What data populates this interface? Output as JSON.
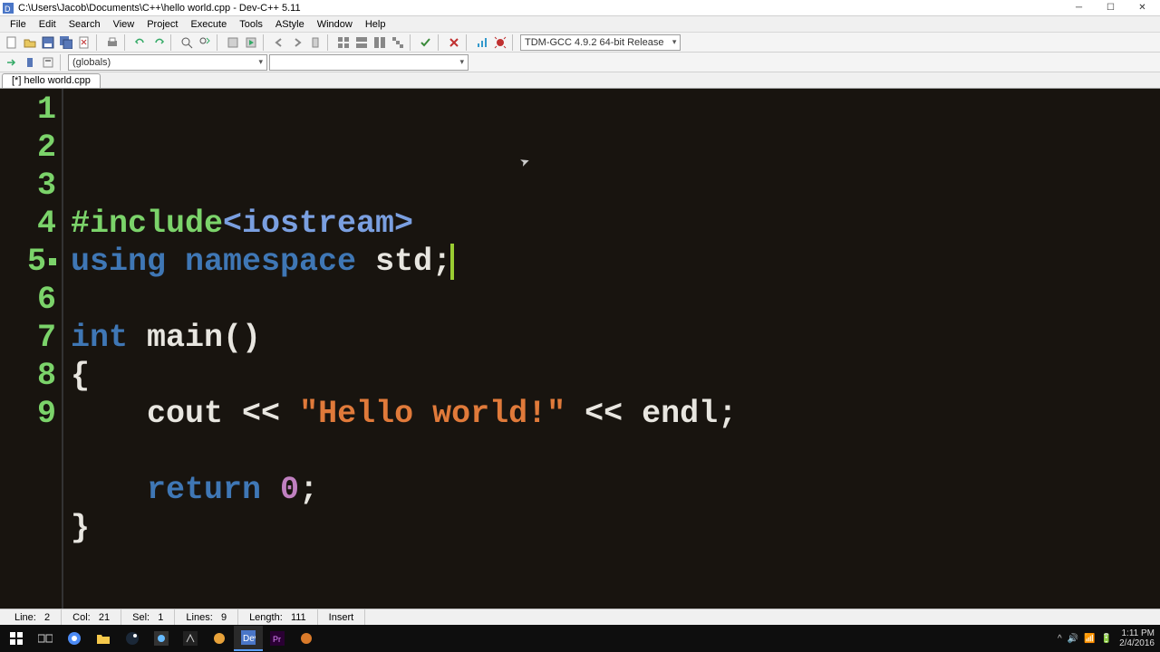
{
  "window": {
    "title": "C:\\Users\\Jacob\\Documents\\C++\\hello world.cpp - Dev-C++ 5.11"
  },
  "menu": {
    "items": [
      "File",
      "Edit",
      "Search",
      "View",
      "Project",
      "Execute",
      "Tools",
      "AStyle",
      "Window",
      "Help"
    ]
  },
  "toolbar": {
    "compiler_select": "TDM-GCC 4.9.2 64-bit Release"
  },
  "toolbar2": {
    "scope_select": "(globals)",
    "member_select": ""
  },
  "tab": {
    "label": "[*] hello world.cpp"
  },
  "code": {
    "lines": [
      {
        "n": "1",
        "tokens": [
          {
            "t": "#include",
            "c": "tok-pre"
          },
          {
            "t": "<iostream>",
            "c": "tok-inc"
          }
        ]
      },
      {
        "n": "2",
        "hl": true,
        "caret": true,
        "tokens": [
          {
            "t": "using namespace ",
            "c": "tok-kw"
          },
          {
            "t": "std",
            "c": "tok-id"
          },
          {
            "t": ";",
            "c": "tok-id"
          }
        ]
      },
      {
        "n": "3",
        "tokens": []
      },
      {
        "n": "4",
        "tokens": [
          {
            "t": "int ",
            "c": "tok-kw"
          },
          {
            "t": "main",
            "c": "tok-id"
          },
          {
            "t": "()",
            "c": "tok-id"
          }
        ]
      },
      {
        "n": "5",
        "fold": true,
        "tokens": [
          {
            "t": "{",
            "c": "tok-id"
          }
        ]
      },
      {
        "n": "6",
        "tokens": [
          {
            "t": "    cout ",
            "c": "tok-id"
          },
          {
            "t": "<<",
            "c": "tok-id"
          },
          {
            "t": " ",
            "c": "tok-id"
          },
          {
            "t": "\"Hello world!\"",
            "c": "tok-str"
          },
          {
            "t": " ",
            "c": "tok-id"
          },
          {
            "t": "<<",
            "c": "tok-id"
          },
          {
            "t": " endl",
            "c": "tok-id"
          },
          {
            "t": ";",
            "c": "tok-id"
          }
        ]
      },
      {
        "n": "7",
        "tokens": []
      },
      {
        "n": "8",
        "tokens": [
          {
            "t": "    ",
            "c": "tok-id"
          },
          {
            "t": "return ",
            "c": "tok-kw"
          },
          {
            "t": "0",
            "c": "tok-num"
          },
          {
            "t": ";",
            "c": "tok-id"
          }
        ]
      },
      {
        "n": "9",
        "tokens": [
          {
            "t": "}",
            "c": "tok-id"
          }
        ]
      }
    ]
  },
  "status": {
    "line_lbl": "Line:",
    "line_val": "2",
    "col_lbl": "Col:",
    "col_val": "21",
    "sel_lbl": "Sel:",
    "sel_val": "1",
    "lines_lbl": "Lines:",
    "lines_val": "9",
    "length_lbl": "Length:",
    "length_val": "111",
    "mode": "Insert"
  },
  "clock": {
    "time": "1:11 PM",
    "date": "2/4/2016"
  },
  "tray_icons": [
    "^",
    "🔊",
    "📶",
    "🔋"
  ]
}
